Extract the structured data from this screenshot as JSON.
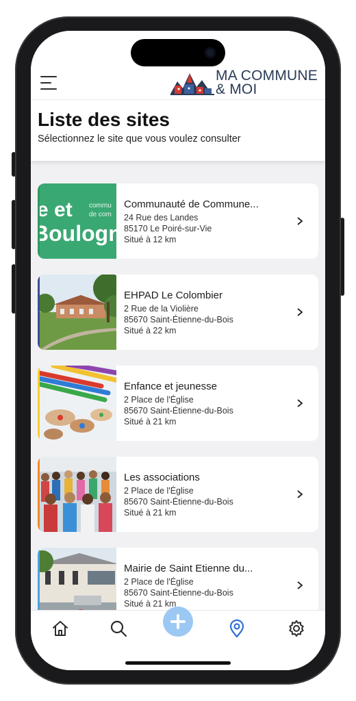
{
  "app": {
    "logo_line1": "MA COMMUNE",
    "logo_line2": "& MOI"
  },
  "page": {
    "title": "Liste des sites",
    "subtitle": "Sélectionnez le site que vous voulez consulter"
  },
  "sites": [
    {
      "name": "Communauté de Commune...",
      "street": "24 Rue des Landes",
      "city": "85170 Le Poiré-sur-Vie",
      "distance": "Situé à 12 km",
      "accent": "#2e9a5e",
      "image": "community-logo"
    },
    {
      "name": "EHPAD Le Colombier",
      "street": "2 Rue de la Violière",
      "city": "85670 Saint-Étienne-du-Bois",
      "distance": "Situé à 22 km",
      "accent": "#3a4c9a",
      "image": "building-garden"
    },
    {
      "name": "Enfance et jeunesse",
      "street": "2 Place de l'Église",
      "city": "85670 Saint-Étienne-du-Bois",
      "distance": "Situé à 21 km",
      "accent": "#f5d02b",
      "image": "colored-pencils"
    },
    {
      "name": "Les associations",
      "street": "2 Place de l'Église",
      "city": "85670 Saint-Étienne-du-Bois",
      "distance": "Situé à 21 km",
      "accent": "#f08a24",
      "image": "crowd"
    },
    {
      "name": "Mairie de Saint Etienne du...",
      "street": "2 Place de l'Église",
      "city": "85670 Saint-Étienne-du-Bois",
      "distance": "Situé à 21 km",
      "accent": "#4aa3e0",
      "image": "town-hall"
    }
  ],
  "tabbar": {
    "items": [
      "home-icon",
      "search-icon",
      "add-icon",
      "location-icon",
      "settings-icon"
    ],
    "active": "location-icon",
    "active_color": "#2f6fd6",
    "fab_color": "#9cc8f4"
  }
}
